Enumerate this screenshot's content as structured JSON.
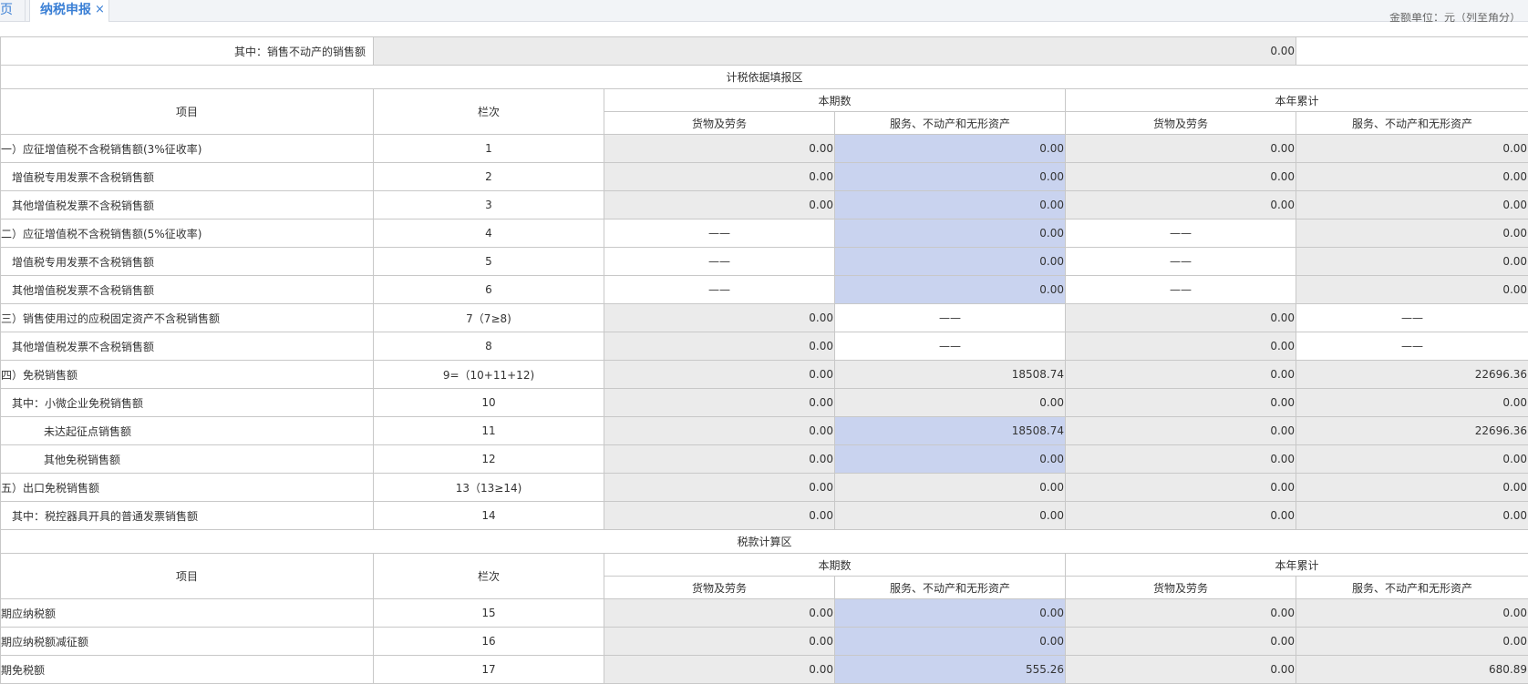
{
  "tabs": {
    "home_label": "页",
    "active_label": "纳税申报",
    "close_glyph": "×"
  },
  "unit_note": "金额单位：元（列至角分）",
  "top_row": {
    "label": "其中：销售不动产的销售额",
    "value": "0.00"
  },
  "section1": {
    "title": "计税依据填报区",
    "headers": {
      "item": "项目",
      "col": "栏次",
      "current": "本期数",
      "ytd": "本年累计",
      "goods": "货物及劳务",
      "services": "服务、不动产和无形资产"
    },
    "rows": [
      {
        "label": "一）应征增值税不含税销售额(3%征收率)",
        "col": "1",
        "c1": "0.00",
        "c2": "0.00",
        "c3": "0.00",
        "c4": "0.00"
      },
      {
        "label": "增值税专用发票不含税销售额",
        "col": "2",
        "c1": "0.00",
        "c2": "0.00",
        "c3": "0.00",
        "c4": "0.00"
      },
      {
        "label": "其他增值税发票不含税销售额",
        "col": "3",
        "c1": "0.00",
        "c2": "0.00",
        "c3": "0.00",
        "c4": "0.00"
      },
      {
        "label": "二）应征增值税不含税销售额(5%征收率)",
        "col": "4",
        "c1": "——",
        "c2": "0.00",
        "c3": "——",
        "c4": "0.00"
      },
      {
        "label": "增值税专用发票不含税销售额",
        "col": "5",
        "c1": "——",
        "c2": "0.00",
        "c3": "——",
        "c4": "0.00"
      },
      {
        "label": "其他增值税发票不含税销售额",
        "col": "6",
        "c1": "——",
        "c2": "0.00",
        "c3": "——",
        "c4": "0.00"
      },
      {
        "label": "三）销售使用过的应税固定资产不含税销售额",
        "col": "7（7≥8)",
        "c1": "0.00",
        "c2": "——",
        "c3": "0.00",
        "c4": "——"
      },
      {
        "label": "其他增值税发票不含税销售额",
        "col": "8",
        "c1": "0.00",
        "c2": "——",
        "c3": "0.00",
        "c4": "——"
      },
      {
        "label": "四）免税销售额",
        "col": "9=（10+11+12)",
        "c1": "0.00",
        "c2": "18508.74",
        "c3": "0.00",
        "c4": "22696.36"
      },
      {
        "label": "其中：小微企业免税销售额",
        "col": "10",
        "c1": "0.00",
        "c2": "0.00",
        "c3": "0.00",
        "c4": "0.00"
      },
      {
        "label": "未达起征点销售额",
        "col": "11",
        "c1": "0.00",
        "c2": "18508.74",
        "c3": "0.00",
        "c4": "22696.36"
      },
      {
        "label": "其他免税销售额",
        "col": "12",
        "c1": "0.00",
        "c2": "0.00",
        "c3": "0.00",
        "c4": "0.00"
      },
      {
        "label": "五）出口免税销售额",
        "col": "13（13≥14)",
        "c1": "0.00",
        "c2": "0.00",
        "c3": "0.00",
        "c4": "0.00"
      },
      {
        "label": "其中：税控器具开具的普通发票销售额",
        "col": "14",
        "c1": "0.00",
        "c2": "0.00",
        "c3": "0.00",
        "c4": "0.00"
      }
    ]
  },
  "section2": {
    "title": "税款计算区",
    "headers": {
      "item": "项目",
      "col": "栏次",
      "current": "本期数",
      "ytd": "本年累计",
      "goods": "货物及劳务",
      "services": "服务、不动产和无形资产"
    },
    "rows": [
      {
        "label": "期应纳税额",
        "col": "15",
        "c1": "0.00",
        "c2": "0.00",
        "c3": "0.00",
        "c4": "0.00"
      },
      {
        "label": "期应纳税额减征额",
        "col": "16",
        "c1": "0.00",
        "c2": "0.00",
        "c3": "0.00",
        "c4": "0.00"
      },
      {
        "label": "期免税额",
        "col": "17",
        "c1": "0.00",
        "c2": "555.26",
        "c3": "0.00",
        "c4": "680.89"
      }
    ]
  }
}
